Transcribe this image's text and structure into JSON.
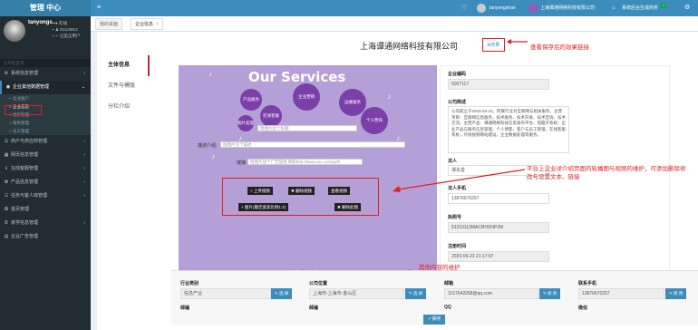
{
  "brand": "管理 中心",
  "user": {
    "name": "tanyongs..",
    "status": "● 在线",
    "id": "• ♟ 5112481​4",
    "auth": "• ✓ 已是正用户"
  },
  "nav_header": "主导航菜单",
  "sidebar": {
    "items": [
      {
        "icon": "⚙",
        "label": "系统信息管理",
        "arrow": "‹"
      },
      {
        "icon": "◉",
        "label": "企业其他数据管理",
        "arrow": "⌄"
      }
    ],
    "sub_items": [
      "企业账户",
      "企业信息",
      "组织管理",
      "角色管理",
      "员工管理"
    ],
    "items_after": [
      {
        "icon": "☰",
        "label": "商户与供应商管理",
        "arrow": "‹"
      },
      {
        "icon": "▦",
        "label": "网页信息管理",
        "arrow": "‹"
      },
      {
        "icon": "ℹ",
        "label": "在线客服管理",
        "arrow": "‹"
      },
      {
        "icon": "✿",
        "label": "产品信息管理",
        "arrow": "‹"
      },
      {
        "icon": "☷",
        "label": "任务与客人库管理",
        "arrow": "‹"
      },
      {
        "icon": "✪",
        "label": "首页管理",
        "arrow": ""
      },
      {
        "icon": "B",
        "label": "家学信息管理",
        "arrow": "‹"
      },
      {
        "icon": "▤",
        "label": "企业广告管理",
        "arrow": ""
      }
    ]
  },
  "topbar": {
    "cart": "🛒",
    "username": "tanyongshan",
    "company": "上海谭通网络科技有限公司",
    "site_link": "系统后台生成商务",
    "badge": "1",
    "cog": "⚙"
  },
  "tabs": {
    "home": "我的桌面",
    "current": "企业信息"
  },
  "left_tabs": [
    "主体信息",
    "文件与模版",
    "分栏介绍"
  ],
  "company_title": "上海谭通网络科技有限公司",
  "preview_link": "⊕效果",
  "preview_note": "查看保存后的效果链接",
  "banner": {
    "title": "Our Services",
    "circles": [
      "产品服务",
      "企业营销",
      "运维服务",
      "在线客服",
      "个人营商",
      "图片处理"
    ],
    "intro_label": "描述介绍:",
    "intro_placeholder": "给图片写个描述",
    "link_label": "链接:",
    "link_placeholder": "给图片加个广告链接,例如http://www.xxx.com/path",
    "title_placeholder": "给图片起个标题",
    "buttons": {
      "upload_video": "+ 上传视频",
      "delete_video": "✖ 删除视频",
      "view_video": "查看视频",
      "upload_image": "+ 图片(最佳宽高比例1:2)",
      "delete_image": "✖ 删除此图"
    },
    "dots": "● ● ○"
  },
  "info": {
    "code_label": "企业编码",
    "code_value": "5007117",
    "intro_label": "公司简述",
    "intro_value": "公司成立于2023-03-23，所属行业为互联网与相关服务，主营项目：互联网信息服务，技术服务、技术开发、技术咨询、技术交流。主营产品：谭通网络科技信息发布平台、电脑子系统；企业产品与服务信息管理，个人博客、客户与员工管理，在线客服系统，外接视频网站建设，企业数据处理等服务。",
    "legal_label": "法人",
    "legal_value": "谭永善",
    "legal_phone_label": "法人手机",
    "legal_phone_value": "13876670257",
    "license_label": "执照号",
    "license_value": "91310113MACBHXNP2M",
    "reg_label": "注册时间",
    "reg_value": "2020-06-23 21:17:07"
  },
  "overlay_note": "平台上企业详介绍页面的轮播图与视频的维护，可添加删除修改与设置文本、链接",
  "other_note": "其他内容的维护",
  "bottom": {
    "industry_label": "行业类别",
    "industry_value": "信息产业",
    "industry_btn": "✎ 选 择",
    "location_label": "公司位置",
    "location_value": "上海市-上海市-金山区",
    "location_btn": "✎ 选 择",
    "email_label": "邮箱",
    "email_value": "1157642058@qq.com",
    "email_btn": "✎ 修 改",
    "phone_label": "联系手机",
    "phone_value": "13876670257",
    "phone_btn": "✎ 修 改",
    "row2": [
      "邮编",
      "邮编",
      "QQ",
      "微信"
    ],
    "save": "✓保存"
  }
}
